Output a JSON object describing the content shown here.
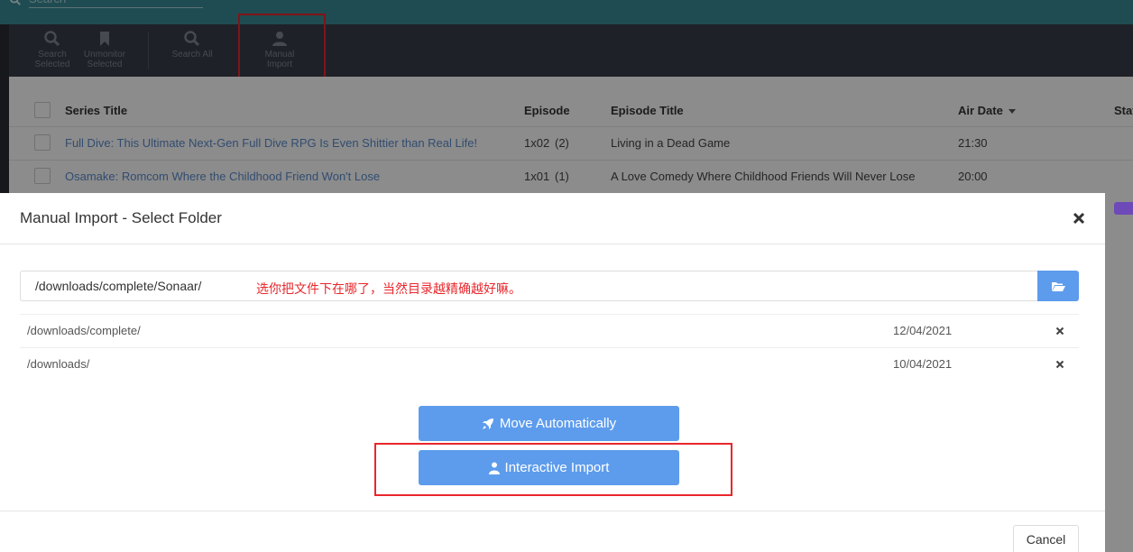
{
  "topbar": {
    "search_placeholder": "Search"
  },
  "toolbar": {
    "search_selected": "Search Selected",
    "unmonitor_selected": "Unmonitor Selected",
    "search_all": "Search All",
    "manual_import": "Manual Import"
  },
  "table": {
    "headers": {
      "series_title": "Series Title",
      "episode": "Episode",
      "episode_title": "Episode Title",
      "air_date": "Air Date",
      "status": "Stat"
    },
    "rows": [
      {
        "series_title": "Full Dive: This Ultimate Next-Gen Full Dive RPG Is Even Shittier than Real Life!",
        "episode": "1x02",
        "absolute": "(2)",
        "episode_title": "Living in a Dead Game",
        "air_date": "21:30"
      },
      {
        "series_title": "Osamake: Romcom Where the Childhood Friend Won't Lose",
        "episode": "1x01",
        "absolute": "(1)",
        "episode_title": "A Love Comedy Where Childhood Friends Will Never Lose",
        "air_date": "20:00"
      }
    ]
  },
  "modal": {
    "title": "Manual Import - Select Folder",
    "path_value": "/downloads/complete/Sonaar/",
    "annotation": "选你把文件下在哪了，当然目录越精确越好嘛。",
    "recent_folders": [
      {
        "path": "/downloads/complete/",
        "date": "12/04/2021"
      },
      {
        "path": "/downloads/",
        "date": "10/04/2021"
      }
    ],
    "move_automatically": "Move Automatically",
    "interactive_import": "Interactive Import",
    "cancel": "Cancel"
  },
  "colors": {
    "accent": "#5d9cec",
    "highlight": "#e8272c",
    "topbar": "#3a8a96",
    "toolbar": "#3a3d4b"
  }
}
